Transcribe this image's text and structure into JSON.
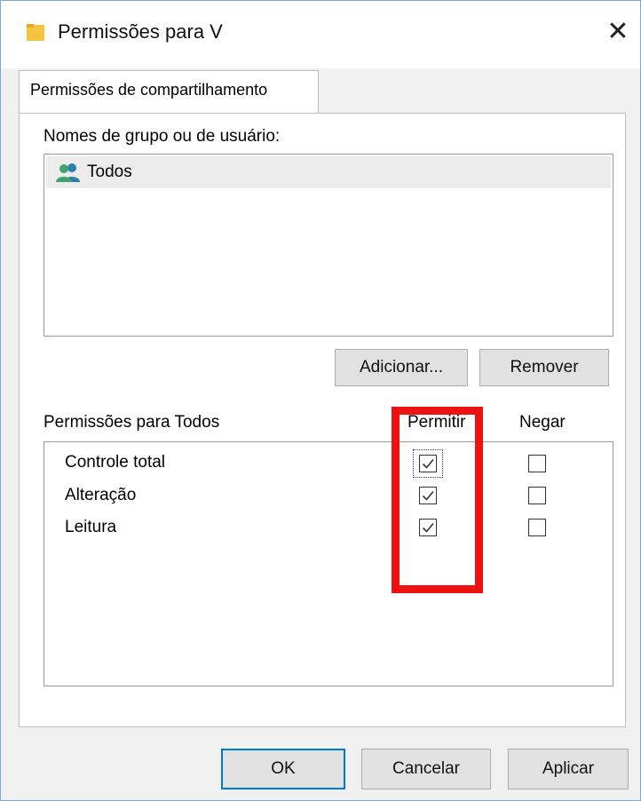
{
  "window": {
    "title": "Permissões para V",
    "close_glyph": "✕"
  },
  "icons": {
    "title": "folder-icon",
    "group_item": "users-icon",
    "close": "close-icon",
    "check": "checkmark-icon"
  },
  "colors": {
    "highlight": "#ee1111",
    "accent": "#0078d7",
    "folder": "#f5c242"
  },
  "tab": {
    "label": "Permissões de compartilhamento"
  },
  "groups": {
    "label": "Nomes de grupo ou de usuário:",
    "items": [
      {
        "label": "Todos",
        "selected": true
      }
    ]
  },
  "group_buttons": {
    "add": "Adicionar...",
    "remove": "Remover"
  },
  "permissions": {
    "label": "Permissões para Todos",
    "columns": {
      "allow": "Permitir",
      "deny": "Negar"
    },
    "rows": [
      {
        "name": "Controle total",
        "allow": true,
        "deny": false
      },
      {
        "name": "Alteração",
        "allow": true,
        "deny": false
      },
      {
        "name": "Leitura",
        "allow": true,
        "deny": false
      }
    ]
  },
  "footer": {
    "ok": "OK",
    "cancel": "Cancelar",
    "apply": "Aplicar"
  }
}
